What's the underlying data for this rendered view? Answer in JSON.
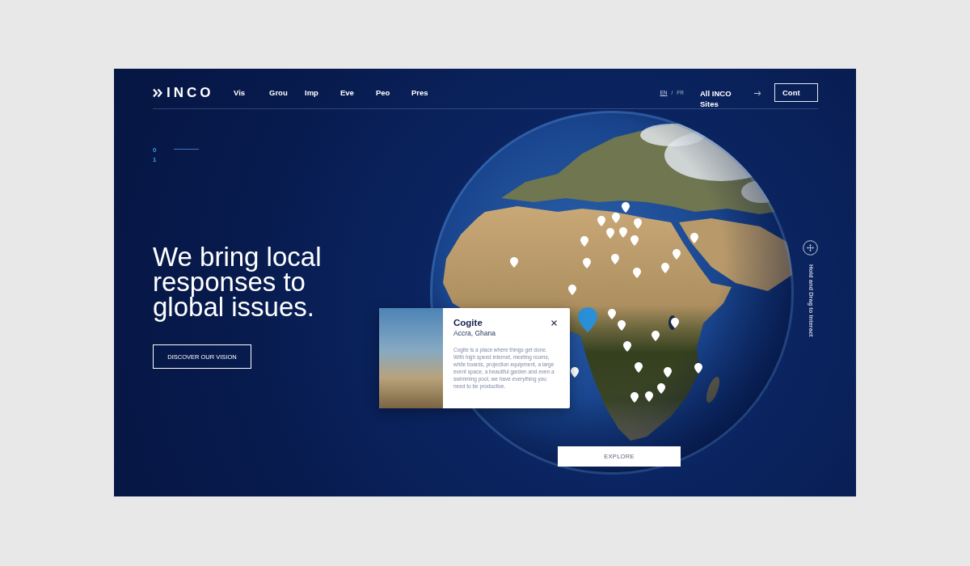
{
  "header": {
    "logo": {
      "text": "INCO"
    },
    "nav": [
      {
        "label": "Vis"
      },
      {
        "label": "Grou"
      },
      {
        "label": "Imp"
      },
      {
        "label": "Eve"
      },
      {
        "label": "Peo"
      },
      {
        "label": "Pres"
      }
    ],
    "languages": [
      {
        "label": "EN",
        "selected": true
      },
      {
        "label": "FR",
        "selected": false
      }
    ],
    "language_separator": "/",
    "sites_link": "All INCO Sites",
    "contact_button": "Cont"
  },
  "slide_counter": "01",
  "hero": {
    "headline": "We bring local responses to global issues.",
    "cta": "DISCOVER OUR VISION"
  },
  "map_pins": [
    {
      "selected": false
    },
    {
      "selected": false
    },
    {
      "selected": false
    },
    {
      "selected": false
    },
    {
      "selected": false
    },
    {
      "selected": false
    },
    {
      "selected": false
    },
    {
      "selected": false
    },
    {
      "selected": false
    },
    {
      "selected": false
    },
    {
      "selected": false
    },
    {
      "selected": false
    },
    {
      "selected": false
    },
    {
      "selected": false
    },
    {
      "selected": false
    },
    {
      "selected": false
    },
    {
      "selected": true
    },
    {
      "selected": false
    },
    {
      "selected": false
    },
    {
      "selected": false
    },
    {
      "selected": false
    },
    {
      "selected": false
    },
    {
      "selected": false
    },
    {
      "selected": false
    },
    {
      "selected": false
    },
    {
      "selected": false
    },
    {
      "selected": false
    },
    {
      "selected": false
    },
    {
      "selected": false
    }
  ],
  "location_card": {
    "title": "Cogite",
    "subtitle": "Accra, Ghana",
    "description": "Cogite is a place where things get done. With high speed internet, meeting rooms, white boards, projection equipment, a large event space, a beautiful garden and even a swimming pool, we have everything you need to be productive."
  },
  "explore_button": "EXPLORE",
  "interaction_hint": "Hold and Drag to Interact"
}
